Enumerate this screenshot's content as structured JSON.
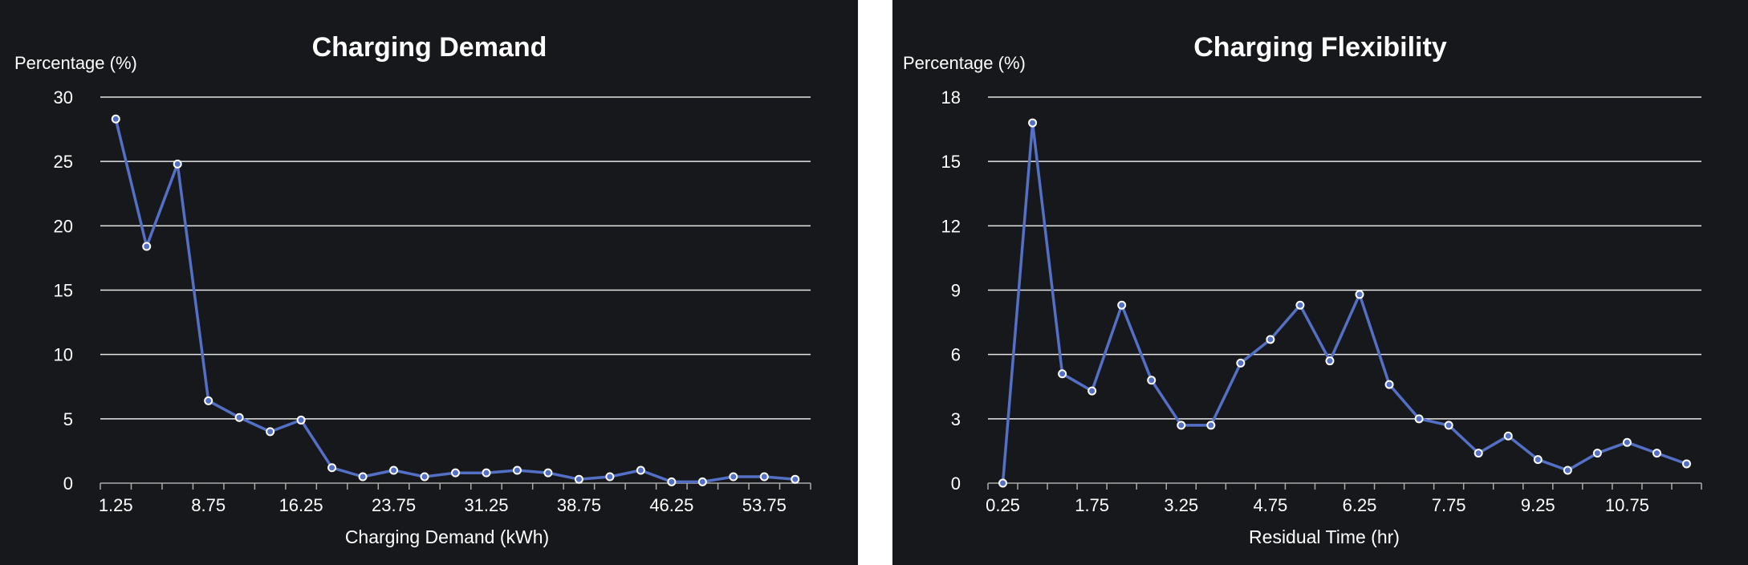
{
  "chart_data": [
    {
      "type": "line",
      "title": "Charging Demand",
      "ylabel": "Percentage (%)",
      "xlabel": "Charging Demand (kWh)",
      "ylim": [
        0,
        30
      ],
      "y_ticks": [
        "0",
        "5",
        "10",
        "15",
        "20",
        "25",
        "30"
      ],
      "x_tick_labels": [
        "1.25",
        "8.75",
        "16.25",
        "23.75",
        "31.25",
        "38.75",
        "46.25",
        "53.75"
      ],
      "x": [
        1.25,
        3.75,
        6.25,
        8.75,
        11.25,
        13.75,
        16.25,
        18.75,
        21.25,
        23.75,
        26.25,
        28.75,
        31.25,
        33.75,
        36.25,
        38.75,
        41.25,
        43.75,
        46.25,
        48.75,
        51.25,
        53.75,
        56.25
      ],
      "grid": true,
      "color": "#5470c6",
      "series": [
        {
          "values": [
            28.3,
            18.4,
            24.8,
            6.4,
            5.1,
            4.0,
            4.9,
            1.2,
            0.5,
            1.0,
            0.5,
            0.8,
            0.8,
            1.0,
            0.8,
            0.3,
            0.5,
            1.0,
            0.1,
            0.1,
            0.5,
            0.5,
            0.3
          ]
        }
      ]
    },
    {
      "type": "line",
      "title": "Charging Flexibility",
      "ylabel": "Percentage (%)",
      "xlabel": "Residual Time (hr)",
      "ylim": [
        0,
        18
      ],
      "y_ticks": [
        "0",
        "3",
        "6",
        "9",
        "12",
        "15",
        "18"
      ],
      "x_tick_labels": [
        "0.25",
        "1.75",
        "3.25",
        "4.75",
        "6.25",
        "7.75",
        "9.25",
        "10.75"
      ],
      "x": [
        0.25,
        0.75,
        1.25,
        1.75,
        2.25,
        2.75,
        3.25,
        3.75,
        4.25,
        4.75,
        5.25,
        5.75,
        6.25,
        6.75,
        7.25,
        7.75,
        8.25,
        8.75,
        9.25,
        9.75,
        10.25,
        10.75,
        11.25,
        11.75
      ],
      "grid": true,
      "color": "#5470c6",
      "series": [
        {
          "values": [
            0.0,
            16.8,
            5.1,
            4.3,
            8.3,
            4.8,
            2.7,
            2.7,
            5.6,
            6.7,
            8.3,
            5.7,
            8.8,
            4.6,
            3.0,
            2.7,
            1.4,
            2.2,
            1.1,
            0.6,
            1.4,
            1.9,
            1.4,
            0.9
          ]
        }
      ]
    }
  ]
}
